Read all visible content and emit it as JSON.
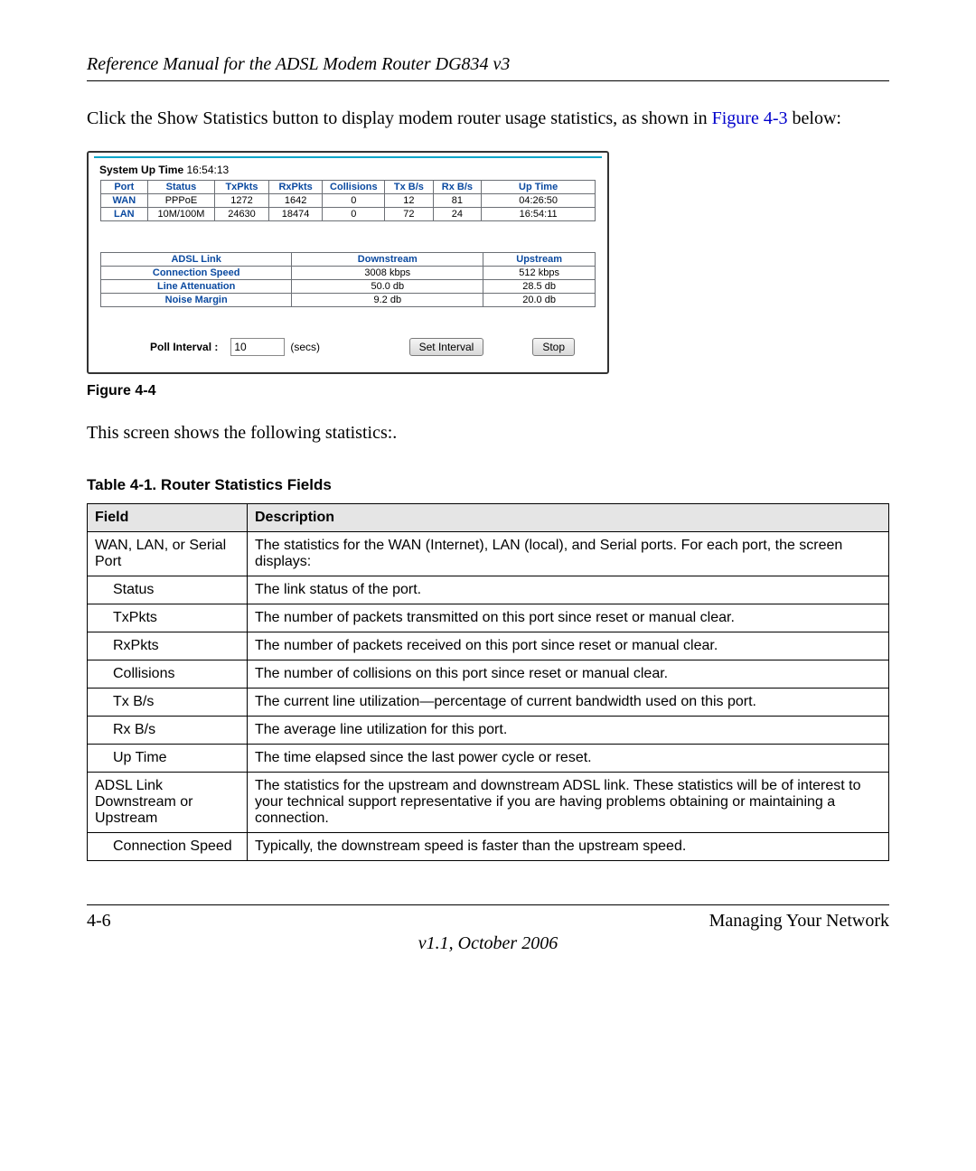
{
  "header_title": "Reference Manual for the ADSL Modem Router DG834 v3",
  "intro": {
    "pre": "Click the Show Statistics button to display modem router usage statistics, as shown in ",
    "figref": "Figure 4-3",
    "post": " below:"
  },
  "screenshot": {
    "system_uptime_label": "System Up Time",
    "system_uptime_value": "16:54:13",
    "stats_headers": [
      "Port",
      "Status",
      "TxPkts",
      "RxPkts",
      "Collisions",
      "Tx B/s",
      "Rx B/s",
      "Up Time"
    ],
    "stats_rows": [
      {
        "port": "WAN",
        "status": "PPPoE",
        "tx": "1272",
        "rx": "1642",
        "col": "0",
        "txbs": "12",
        "rxbs": "81",
        "up": "04:26:50"
      },
      {
        "port": "LAN",
        "status": "10M/100M",
        "tx": "24630",
        "rx": "18474",
        "col": "0",
        "txbs": "72",
        "rxbs": "24",
        "up": "16:54:11"
      }
    ],
    "adsl_headers": [
      "ADSL Link",
      "Downstream",
      "Upstream"
    ],
    "adsl_rows": [
      {
        "label": "Connection Speed",
        "down": "3008 kbps",
        "up": "512 kbps"
      },
      {
        "label": "Line Attenuation",
        "down": "50.0 db",
        "up": "28.5 db"
      },
      {
        "label": "Noise Margin",
        "down": "9.2 db",
        "up": "20.0 db"
      }
    ],
    "poll_label": "Poll Interval :",
    "poll_value": "10",
    "poll_unit": "(secs)",
    "set_btn": "Set Interval",
    "stop_btn": "Stop"
  },
  "figure_caption": "Figure 4-4",
  "after_fig_text": "This screen shows the following statistics:.",
  "table_title": "Table 4-1. Router Statistics Fields",
  "desc_table": {
    "headers": [
      "Field",
      "Description"
    ],
    "rows": [
      {
        "field": "WAN, LAN, or Serial Port",
        "sub": false,
        "desc": "The statistics for the WAN (Internet), LAN (local), and Serial ports. For each port, the screen displays:"
      },
      {
        "field": "Status",
        "sub": true,
        "desc": "The link status of the port."
      },
      {
        "field": "TxPkts",
        "sub": true,
        "desc": "The number of packets transmitted on this port since reset or manual clear."
      },
      {
        "field": "RxPkts",
        "sub": true,
        "desc": "The number of packets received on this port since reset or manual clear."
      },
      {
        "field": "Collisions",
        "sub": true,
        "desc": "The number of collisions on this port since reset or manual clear."
      },
      {
        "field": "Tx B/s",
        "sub": true,
        "desc": "The current line utilization—percentage of current bandwidth used on this port."
      },
      {
        "field": "Rx B/s",
        "sub": true,
        "desc": "The average line utilization for this port."
      },
      {
        "field": "Up Time",
        "sub": true,
        "desc": "The time elapsed since the last power cycle or reset."
      },
      {
        "field": "ADSL Link Downstream or Upstream",
        "sub": false,
        "desc": "The statistics for the upstream and downstream ADSL link. These statistics will be of interest to your technical support representative if you are having problems obtaining or maintaining a connection."
      },
      {
        "field": "Connection Speed",
        "sub": true,
        "desc": "Typically, the downstream speed is faster than the upstream speed."
      }
    ]
  },
  "footer": {
    "page": "4-6",
    "section": "Managing Your Network",
    "version": "v1.1, October 2006"
  }
}
